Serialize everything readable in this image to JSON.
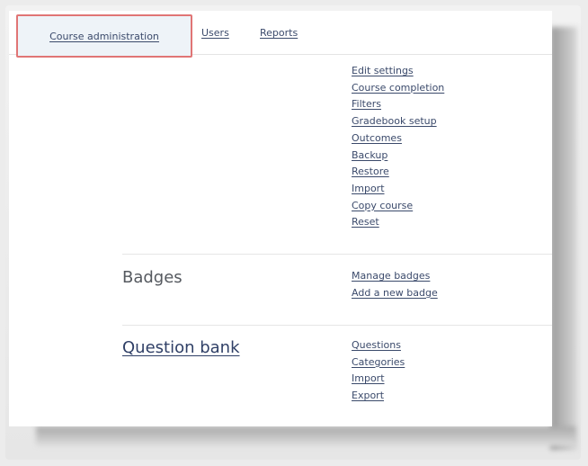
{
  "nav": {
    "tabs": [
      {
        "label": "Course administration",
        "active": true
      },
      {
        "label": "Users",
        "active": false
      },
      {
        "label": "Reports",
        "active": false
      }
    ]
  },
  "sections": {
    "course": {
      "title": "",
      "links": [
        "Edit settings",
        "Course completion",
        "Filters",
        "Gradebook setup",
        "Outcomes",
        "Backup",
        "Restore",
        "Import",
        "Copy course",
        "Reset"
      ]
    },
    "badges": {
      "title": "Badges",
      "links": [
        "Manage badges",
        "Add a new badge"
      ]
    },
    "question_bank": {
      "title": "Question bank",
      "links": [
        "Questions",
        "Categories",
        "Import",
        "Export"
      ]
    }
  },
  "colors": {
    "highlight_border": "#e07575",
    "link": "#3b4a6b"
  }
}
